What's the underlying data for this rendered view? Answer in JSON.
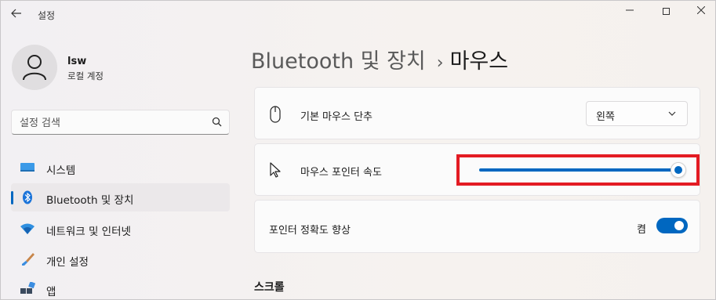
{
  "window": {
    "title": "설정"
  },
  "user": {
    "name": "lsw",
    "account_type": "로컬 계정"
  },
  "search": {
    "placeholder": "설정 검색"
  },
  "sidebar": {
    "items": [
      {
        "label": "시스템",
        "icon": "monitor-icon",
        "active": false
      },
      {
        "label": "Bluetooth 및 장치",
        "icon": "bluetooth-icon",
        "active": true
      },
      {
        "label": "네트워크 및 인터넷",
        "icon": "wifi-icon",
        "active": false
      },
      {
        "label": "개인 설정",
        "icon": "brush-icon",
        "active": false
      },
      {
        "label": "앱",
        "icon": "apps-icon",
        "active": false
      }
    ]
  },
  "breadcrumb": {
    "parent": "Bluetooth 및 장치",
    "separator": "›",
    "current": "마우스"
  },
  "settings": {
    "primary_button": {
      "label": "기본 마우스 단추",
      "value": "왼쪽",
      "icon": "mouse-icon"
    },
    "pointer_speed": {
      "label": "마우스 포인터 속도",
      "value_fraction": 1.0,
      "icon": "cursor-icon"
    },
    "pointer_precision": {
      "label": "포인터 정확도 향상",
      "state_label": "켬",
      "on": true
    }
  },
  "section": {
    "scroll_title": "스크롤"
  },
  "colors": {
    "accent": "#0067c0",
    "highlight": "#e31b23"
  }
}
